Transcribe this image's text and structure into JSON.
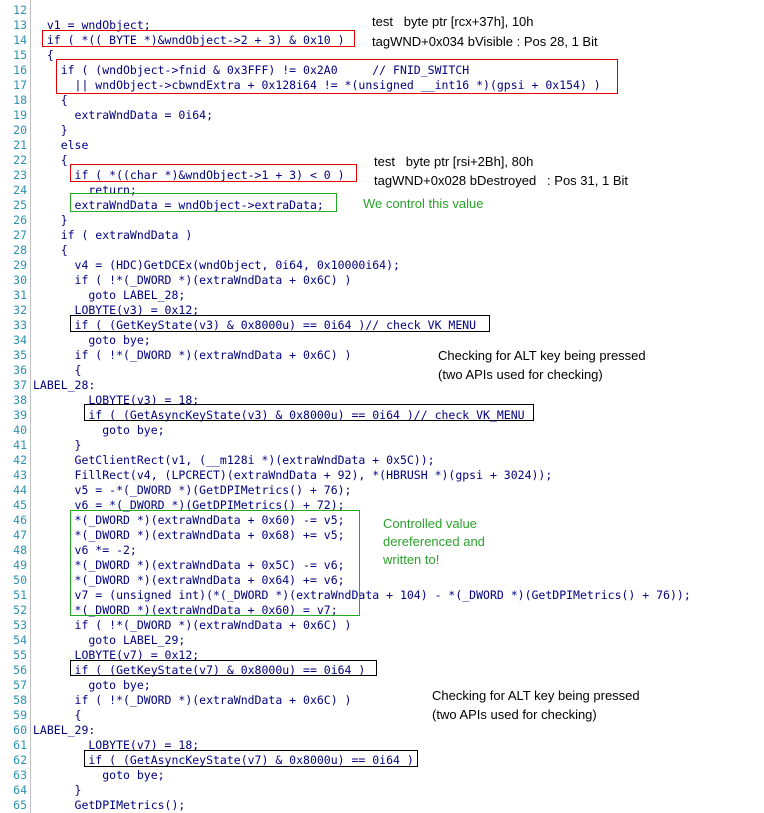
{
  "lines": [
    {
      "n": "12",
      "text": ""
    },
    {
      "n": "13",
      "text": "  v1 = wndObject;"
    },
    {
      "n": "14",
      "text": "  if ( *((_BYTE *)&wndObject->2 + 3) & 0x10 )"
    },
    {
      "n": "15",
      "text": "  {"
    },
    {
      "n": "16",
      "text": "    if ( (wndObject->fnid & 0x3FFF) != 0x2A0     // FNID_SWITCH"
    },
    {
      "n": "17",
      "text": "      || wndObject->cbwndExtra + 0x128i64 != *(unsigned __int16 *)(gpsi + 0x154) )"
    },
    {
      "n": "18",
      "text": "    {"
    },
    {
      "n": "19",
      "text": "      extraWndData = 0i64;"
    },
    {
      "n": "20",
      "text": "    }"
    },
    {
      "n": "21",
      "text": "    else"
    },
    {
      "n": "22",
      "text": "    {"
    },
    {
      "n": "23",
      "text": "      if ( *((char *)&wndObject->1 + 3) < 0 )"
    },
    {
      "n": "24",
      "text": "        return;"
    },
    {
      "n": "25",
      "text": "      extraWndData = wndObject->extraData;"
    },
    {
      "n": "26",
      "text": "    }"
    },
    {
      "n": "27",
      "text": "    if ( extraWndData )"
    },
    {
      "n": "28",
      "text": "    {"
    },
    {
      "n": "29",
      "text": "      v4 = (HDC)GetDCEx(wndObject, 0i64, 0x10000i64);"
    },
    {
      "n": "30",
      "text": "      if ( !*(_DWORD *)(extraWndData + 0x6C) )"
    },
    {
      "n": "31",
      "text": "        goto LABEL_28;"
    },
    {
      "n": "32",
      "text": "      LOBYTE(v3) = 0x12;"
    },
    {
      "n": "33",
      "text": "      if ( (GetKeyState(v3) & 0x8000u) == 0i64 )// check VK_MENU"
    },
    {
      "n": "34",
      "text": "        goto bye;"
    },
    {
      "n": "35",
      "text": "      if ( !*(_DWORD *)(extraWndData + 0x6C) )"
    },
    {
      "n": "36",
      "text": "      {"
    },
    {
      "n": "37",
      "text": "LABEL_28:"
    },
    {
      "n": "38",
      "text": "        LOBYTE(v3) = 18;"
    },
    {
      "n": "39",
      "text": "        if ( (GetAsyncKeyState(v3) & 0x8000u) == 0i64 )// check VK_MENU"
    },
    {
      "n": "40",
      "text": "          goto bye;"
    },
    {
      "n": "41",
      "text": "      }"
    },
    {
      "n": "42",
      "text": "      GetClientRect(v1, (__m128i *)(extraWndData + 0x5C));"
    },
    {
      "n": "43",
      "text": "      FillRect(v4, (LPCRECT)(extraWndData + 92), *(HBRUSH *)(gpsi + 3024));"
    },
    {
      "n": "44",
      "text": "      v5 = -*(_DWORD *)(GetDPIMetrics() + 76);"
    },
    {
      "n": "45",
      "text": "      v6 = *(_DWORD *)(GetDPIMetrics() + 72);"
    },
    {
      "n": "46",
      "text": "      *(_DWORD *)(extraWndData + 0x60) -= v5;"
    },
    {
      "n": "47",
      "text": "      *(_DWORD *)(extraWndData + 0x68) += v5;"
    },
    {
      "n": "48",
      "text": "      v6 *= -2;"
    },
    {
      "n": "49",
      "text": "      *(_DWORD *)(extraWndData + 0x5C) -= v6;"
    },
    {
      "n": "50",
      "text": "      *(_DWORD *)(extraWndData + 0x64) += v6;"
    },
    {
      "n": "51",
      "text": "      v7 = (unsigned int)(*(_DWORD *)(extraWndData + 104) - *(_DWORD *)(GetDPIMetrics() + 76));"
    },
    {
      "n": "52",
      "text": "      *(_DWORD *)(extraWndData + 0x60) = v7;"
    },
    {
      "n": "53",
      "text": "      if ( !*(_DWORD *)(extraWndData + 0x6C) )"
    },
    {
      "n": "54",
      "text": "        goto LABEL_29;"
    },
    {
      "n": "55",
      "text": "      LOBYTE(v7) = 0x12;"
    },
    {
      "n": "56",
      "text": "      if ( (GetKeyState(v7) & 0x8000u) == 0i64 )"
    },
    {
      "n": "57",
      "text": "        goto bye;"
    },
    {
      "n": "58",
      "text": "      if ( !*(_DWORD *)(extraWndData + 0x6C) )"
    },
    {
      "n": "59",
      "text": "      {"
    },
    {
      "n": "60",
      "text": "LABEL_29:"
    },
    {
      "n": "61",
      "text": "        LOBYTE(v7) = 18;"
    },
    {
      "n": "62",
      "text": "        if ( (GetAsyncKeyState(v7) & 0x8000u) == 0i64 )"
    },
    {
      "n": "63",
      "text": "          goto bye;"
    },
    {
      "n": "64",
      "text": "      }"
    },
    {
      "n": "65",
      "text": "      GetDPIMetrics();"
    }
  ],
  "annotations": {
    "visible_1": "test   byte ptr [rcx+37h], 10h",
    "visible_2": "tagWND+0x034 bVisible : Pos 28, 1 Bit",
    "destroyed_1": "test   byte ptr [rsi+2Bh], 80h",
    "destroyed_2": "tagWND+0x028 bDestroyed   : Pos 31, 1 Bit",
    "control_value": "We control this value",
    "alt_check_a_1": "Checking for ALT key being pressed",
    "alt_check_a_2": "(two APIs used for checking)",
    "controlled_1": "Controlled value",
    "controlled_2": "dereferenced and",
    "controlled_3": "written to!",
    "alt_check_b_1": "Checking for ALT key being pressed",
    "alt_check_b_2": "(two APIs used for checking)"
  },
  "colors": {
    "line_number": "#2b91af",
    "keyword_code": "#000080",
    "comment": "#008000",
    "red_box": "#e00000",
    "green_box": "#22aa22",
    "black_box": "#000000",
    "green_annotation": "#2aa32a"
  }
}
